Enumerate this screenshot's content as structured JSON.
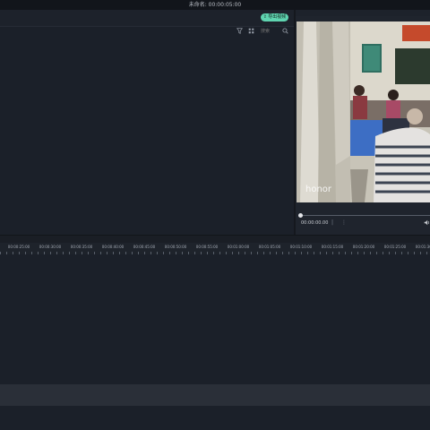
{
  "window": {
    "title": "未命名: 00:00:05:00"
  },
  "toolbar": {
    "export_label": "导出视频",
    "export_icon": "export-icon"
  },
  "library": {
    "search_placeholder": "搜索",
    "icons": [
      "filter-icon",
      "grid-view-icon",
      "search-icon"
    ]
  },
  "preview": {
    "timecode": "00:00:00.00",
    "watermark": "honor",
    "playback_progress": 0,
    "controls": [
      "pipe-separator",
      "more-icon",
      "volume-icon"
    ]
  },
  "timeline": {
    "ruler_labels": [
      "00:00:25:00",
      "00:00:30:00",
      "00:00:35:00",
      "00:00:40:00",
      "00:00:45:00",
      "00:00:50:00",
      "00:00:55:00",
      "00:01:00:00",
      "00:01:05:00",
      "00:01:10:00",
      "00:01:15:00",
      "00:01:20:00",
      "00:01:25:00",
      "00:01:30:00"
    ]
  },
  "colors": {
    "accent": "#5fd4b0",
    "background": "#1b1f27"
  }
}
